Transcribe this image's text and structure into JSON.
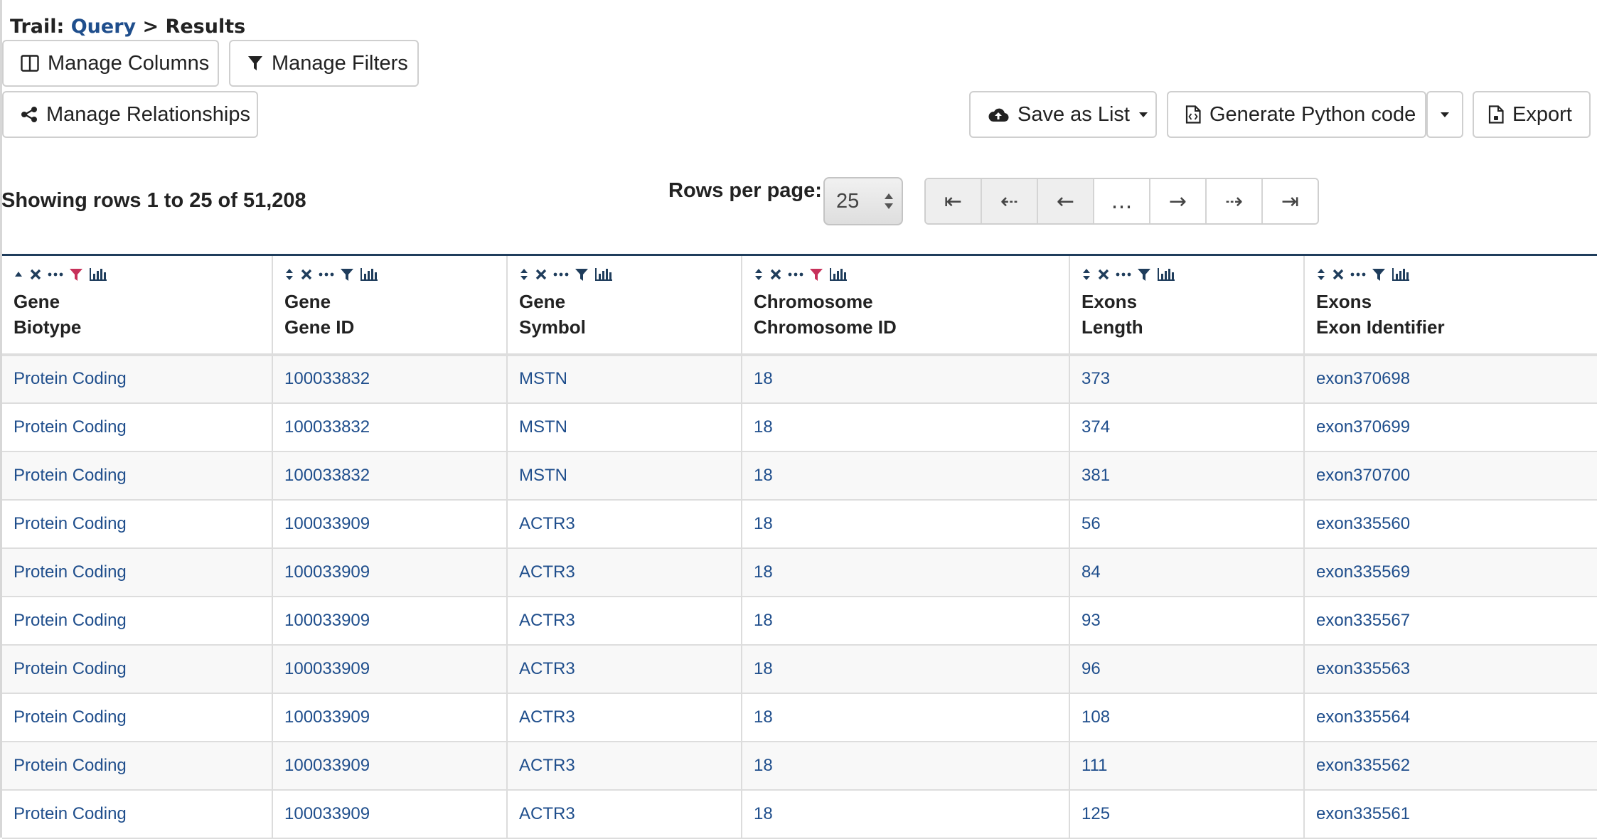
{
  "trail": {
    "prefix": "Trail:",
    "query_link": "Query",
    "separator": ">",
    "current": "Results"
  },
  "toolbar": {
    "manage_columns": "Manage Columns",
    "manage_filters": "Manage Filters",
    "manage_relationships": "Manage Relationships",
    "save_as_list": "Save as List",
    "generate_python": "Generate Python code",
    "export": "Export"
  },
  "status": {
    "showing": "Showing rows 1 to 25 of 51,208"
  },
  "pagination": {
    "rows_per_page_label": "Rows per page:",
    "rows_per_page_value": "25",
    "buttons": [
      "⇤",
      "⇠",
      "←",
      "…",
      "→",
      "⇢",
      "⇥"
    ]
  },
  "colors": {
    "link": "#1f4e8c",
    "active_filter": "#c7315a",
    "header_rule": "#1f3d5c"
  },
  "table": {
    "columns": [
      {
        "line1": "Gene",
        "line2": "Biotype",
        "sort": "asc",
        "filter_active": true
      },
      {
        "line1": "Gene",
        "line2": "Gene ID",
        "sort": "both",
        "filter_active": false
      },
      {
        "line1": "Gene",
        "line2": "Symbol",
        "sort": "both",
        "filter_active": false
      },
      {
        "line1": "Chromosome",
        "line2": "Chromosome ID",
        "sort": "both",
        "filter_active": true
      },
      {
        "line1": "Exons",
        "line2": "Length",
        "sort": "both",
        "filter_active": false
      },
      {
        "line1": "Exons",
        "line2": "Exon Identifier",
        "sort": "both",
        "filter_active": false
      }
    ],
    "rows": [
      [
        "Protein Coding",
        "100033832",
        "MSTN",
        "18",
        "373",
        "exon370698"
      ],
      [
        "Protein Coding",
        "100033832",
        "MSTN",
        "18",
        "374",
        "exon370699"
      ],
      [
        "Protein Coding",
        "100033832",
        "MSTN",
        "18",
        "381",
        "exon370700"
      ],
      [
        "Protein Coding",
        "100033909",
        "ACTR3",
        "18",
        "56",
        "exon335560"
      ],
      [
        "Protein Coding",
        "100033909",
        "ACTR3",
        "18",
        "84",
        "exon335569"
      ],
      [
        "Protein Coding",
        "100033909",
        "ACTR3",
        "18",
        "93",
        "exon335567"
      ],
      [
        "Protein Coding",
        "100033909",
        "ACTR3",
        "18",
        "96",
        "exon335563"
      ],
      [
        "Protein Coding",
        "100033909",
        "ACTR3",
        "18",
        "108",
        "exon335564"
      ],
      [
        "Protein Coding",
        "100033909",
        "ACTR3",
        "18",
        "111",
        "exon335562"
      ],
      [
        "Protein Coding",
        "100033909",
        "ACTR3",
        "18",
        "125",
        "exon335561"
      ]
    ]
  }
}
